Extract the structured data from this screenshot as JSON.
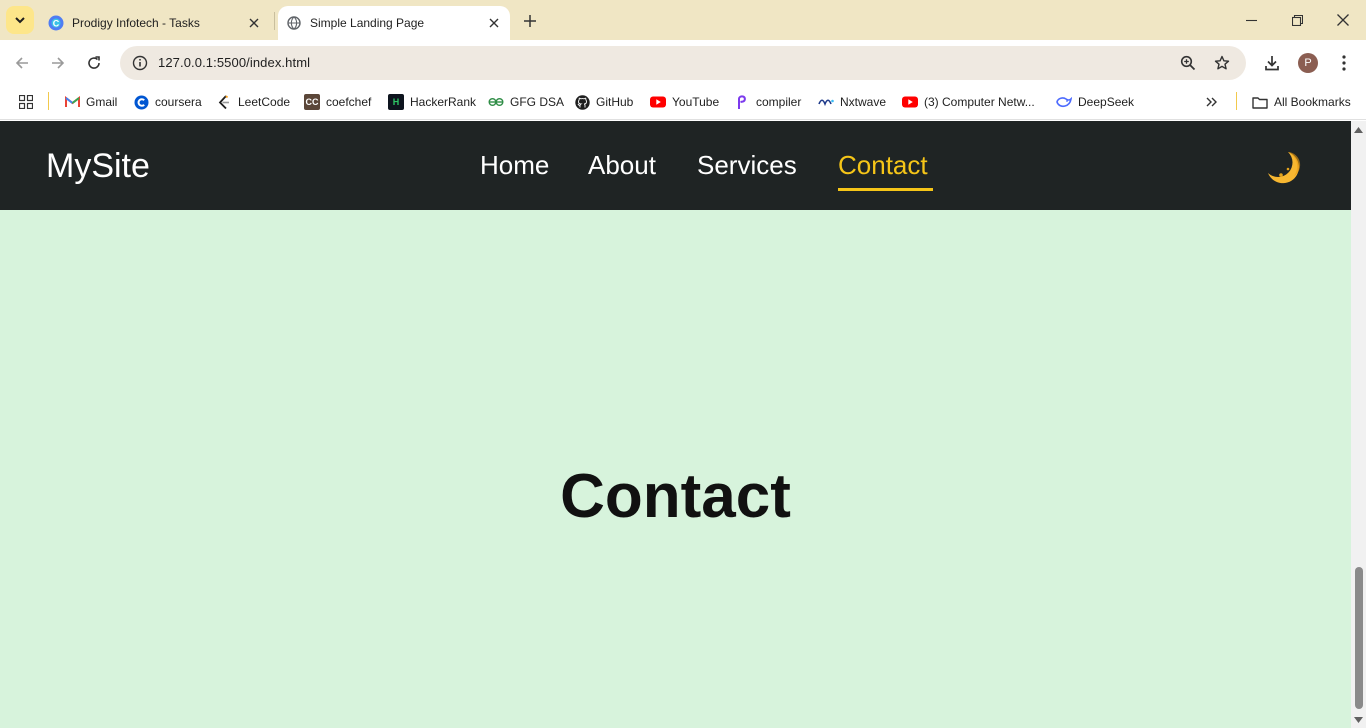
{
  "browser": {
    "tabs": [
      {
        "title": "Prodigy Infotech - Tasks",
        "active": false
      },
      {
        "title": "Simple Landing Page",
        "active": true
      }
    ],
    "url": "127.0.0.1:5500/index.html",
    "avatar_letter": "P",
    "bookmarks": [
      {
        "label": "Gmail",
        "icon": "gmail-icon"
      },
      {
        "label": "coursera",
        "icon": "coursera-icon"
      },
      {
        "label": "LeetCode",
        "icon": "leetcode-icon"
      },
      {
        "label": "coefchef",
        "icon": "codechef-icon"
      },
      {
        "label": "HackerRank",
        "icon": "hackerrank-icon"
      },
      {
        "label": "GFG DSA",
        "icon": "gfg-icon"
      },
      {
        "label": "GitHub",
        "icon": "github-icon"
      },
      {
        "label": "YouTube",
        "icon": "youtube-icon"
      },
      {
        "label": "compiler",
        "icon": "compiler-icon"
      },
      {
        "label": "Nxtwave",
        "icon": "nxtwave-icon"
      },
      {
        "label": "(3) Computer Netw...",
        "icon": "youtube-icon"
      },
      {
        "label": "DeepSeek",
        "icon": "deepseek-icon"
      }
    ],
    "all_bookmarks_label": "All Bookmarks"
  },
  "site": {
    "logo": "MySite",
    "nav": [
      {
        "label": "Home",
        "active": false
      },
      {
        "label": "About",
        "active": false
      },
      {
        "label": "Services",
        "active": false
      },
      {
        "label": "Contact",
        "active": true
      }
    ],
    "theme_toggle_icon": "moon-icon",
    "hero_title": "Contact"
  },
  "colors": {
    "nav_bg": "#1f2424",
    "accent": "#f5c518",
    "page_bg": "#d7f3dc",
    "tabstrip_bg": "#f0e6c4"
  }
}
